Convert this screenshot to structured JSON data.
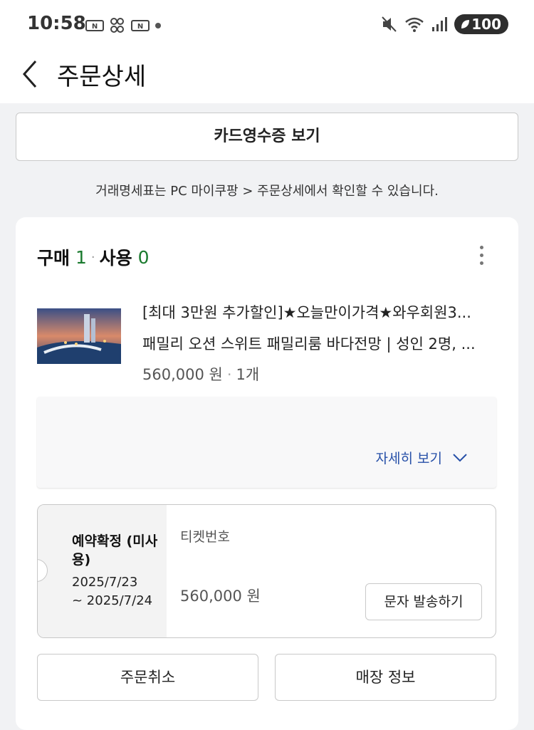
{
  "status_bar": {
    "time": "10:58",
    "battery": "100",
    "icons": [
      "naver-news-icon",
      "game-icon",
      "naver-news-icon",
      "dot-icon",
      "mute-icon",
      "wifi-icon",
      "signal-icon",
      "battery-icon"
    ]
  },
  "header": {
    "title": "주문상세",
    "back_icon": "chevron-left-icon"
  },
  "receipt_button": "카드영수증 보기",
  "notice": "거래명세표는 PC 마이쿠팡 > 주문상세에서 확인할 수 있습니다.",
  "order": {
    "purchase_label": "구매",
    "purchase_count": "1",
    "use_label": "사용",
    "use_count": "0",
    "product_line1": "[최대 3만원 추가할인]★오늘만이가격★와우회원3...",
    "product_line2": "패밀리 오션 스위트 패밀리룸 바다전망 | 성인 2명, ...",
    "price": "560,000 원",
    "quantity": "1개",
    "detail_link": "자세히 보기",
    "ticket": {
      "status": "예약확정 (미사용)",
      "date_start": "2025/7/23",
      "date_end": "~ 2025/7/24",
      "label": "티켓번호",
      "price": "560,000 원",
      "sms_button": "문자 발송하기"
    },
    "cancel_button": "주문취소",
    "store_button": "매장 정보"
  },
  "colors": {
    "count_green": "#1a7a2e",
    "link_blue": "#2750a8",
    "background": "#f1f2f4"
  }
}
